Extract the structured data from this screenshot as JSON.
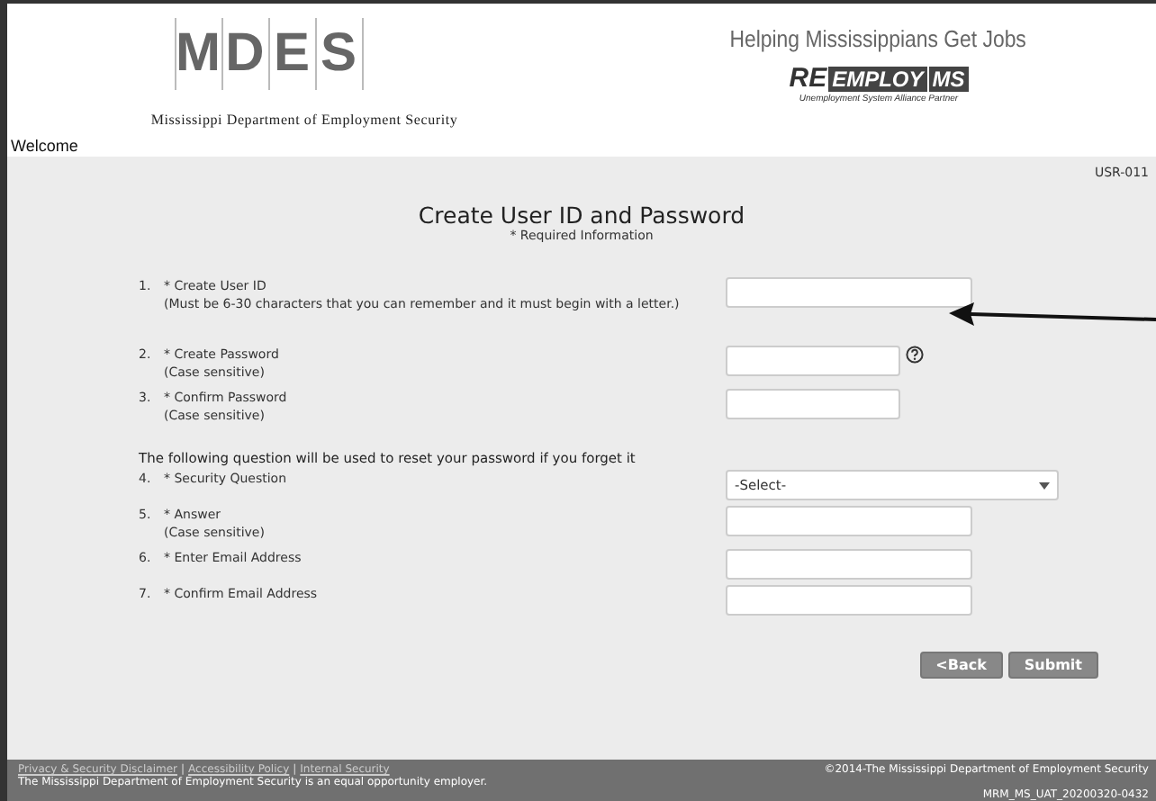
{
  "header": {
    "logo_letters": [
      "M",
      "D",
      "E",
      "S"
    ],
    "agency": "Mississippi Department of Employment Security",
    "tagline": "Helping Mississippians Get Jobs",
    "partner_logo": {
      "re": "RE",
      "employ": "EMPLOY",
      "ms": "MS",
      "caption": "Unemployment System Alliance Partner"
    },
    "welcome": "Welcome"
  },
  "page_id": "USR-011",
  "title": "Create User ID and Password",
  "required_note": "* Required Information",
  "fields": [
    {
      "kind": "input",
      "number": "1.",
      "label": "* Create User ID",
      "note": "(Must be 6-30 characters that you can remember and it must begin with a letter.)",
      "help": false
    },
    {
      "kind": "password",
      "number": "2.",
      "label": "* Create Password",
      "note": "(Case sensitive)",
      "help": true
    },
    {
      "kind": "password",
      "number": "3.",
      "label": "* Confirm Password",
      "note": "(Case sensitive)",
      "help": false
    },
    {
      "kind": "section",
      "text": "The following question will be used to reset your password if you forget it"
    },
    {
      "kind": "select",
      "number": "4.",
      "label": "* Security Question",
      "value": "-Select-"
    },
    {
      "kind": "input",
      "number": "5.",
      "label": "* Answer",
      "note": "(Case sensitive)",
      "help": false
    },
    {
      "kind": "input",
      "number": "6.",
      "label": "* Enter Email Address",
      "help": false
    },
    {
      "kind": "input",
      "number": "7.",
      "label": "* Confirm Email Address",
      "help": false
    }
  ],
  "buttons": [
    "<Back",
    "Submit"
  ],
  "footer": {
    "links": [
      "Privacy & Security Disclaimer",
      "Accessibility Policy",
      "Internal Security"
    ],
    "separator": "|",
    "eoe": "The Mississippi Department of Employment Security is an equal opportunity employer.",
    "copyright": "©2014-The Mississippi Department of Employment Security",
    "build": "MRM_MS_UAT_20200320-0432"
  }
}
